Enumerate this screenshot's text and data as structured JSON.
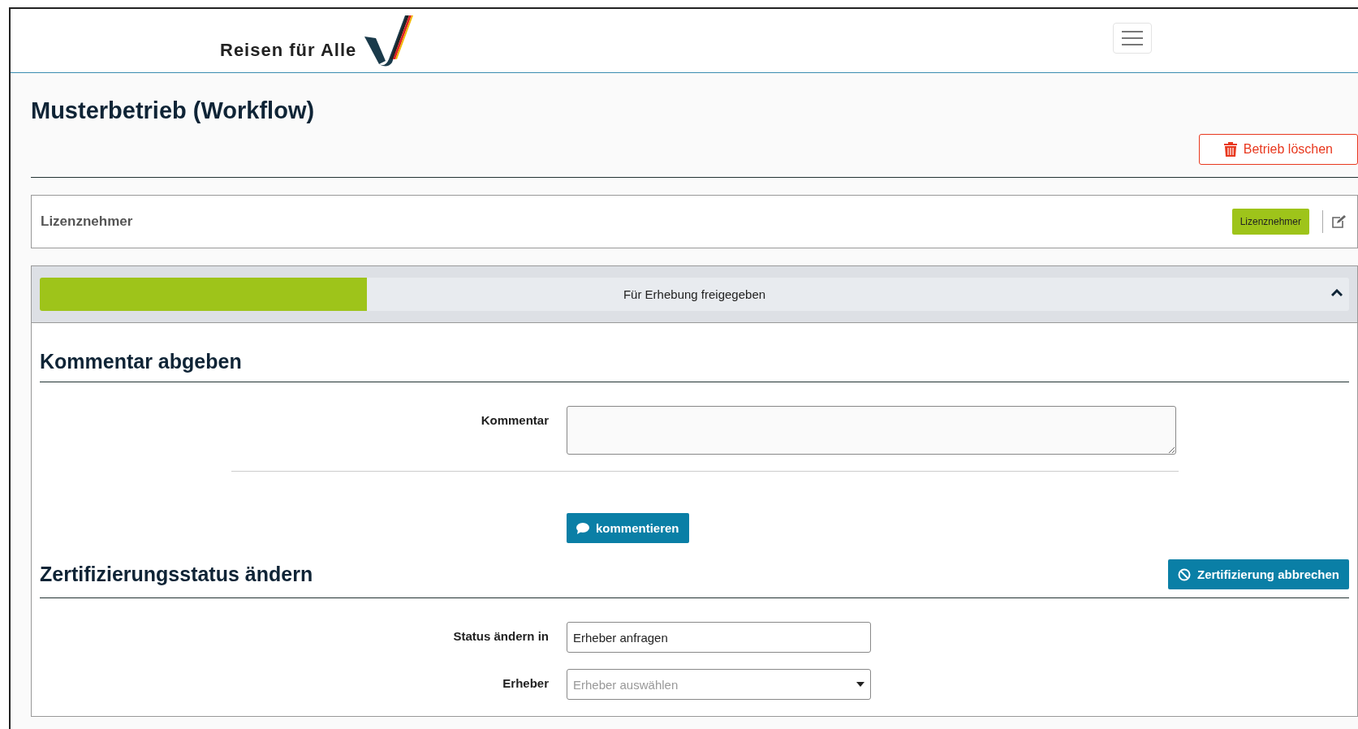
{
  "header": {
    "logo_text": "Reisen für Alle"
  },
  "page": {
    "title": "Musterbetrieb (Workflow)",
    "delete_button": "Betrieb löschen"
  },
  "licensee_card": {
    "title": "Lizenznehmer",
    "badge": "Lizenznehmer"
  },
  "progress": {
    "label": "Für Erhebung freigegeben",
    "level": 0.25,
    "expanded": true
  },
  "comment_section": {
    "heading": "Kommentar abgeben",
    "field_label": "Kommentar",
    "button": "kommentieren"
  },
  "status_section": {
    "heading": "Zertifizierungsstatus ändern",
    "cancel_button": "Zertifizierung abbrechen",
    "fields": [
      {
        "kind": "text",
        "label": "Status ändern in",
        "value": "Erheber anfragen"
      },
      {
        "kind": "select",
        "label": "Erheber",
        "placeholder": "Erheber auswählen"
      }
    ]
  }
}
